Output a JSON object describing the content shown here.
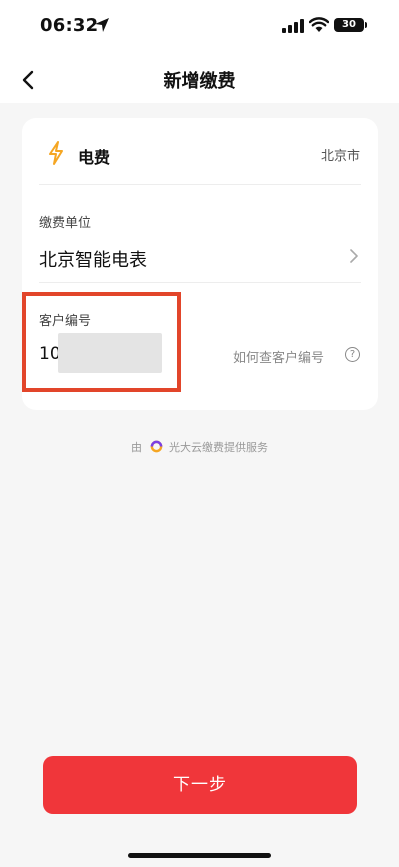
{
  "status_bar": {
    "time": "06:32",
    "battery": "30",
    "icons": [
      "location-arrow-icon",
      "signal-icon",
      "wifi-icon",
      "battery-icon"
    ]
  },
  "nav": {
    "title": "新增缴费",
    "back_icon": "chevron-left-icon"
  },
  "card": {
    "type_icon": "lightning-bolt-icon",
    "type_label": "电费",
    "city": "北京市",
    "unit_label": "缴费单位",
    "unit_value": "北京智能电表",
    "customer_label": "客户编号",
    "customer_value": "10",
    "help_text": "如何查客户编号",
    "help_icon_glyph": "?"
  },
  "provider": {
    "prefix": "由",
    "name": "光大云缴费提供服务"
  },
  "next_button": "下一步",
  "colors": {
    "accent": "#f0363a",
    "highlight": "#e2452a",
    "bolt": "#f5a623"
  }
}
